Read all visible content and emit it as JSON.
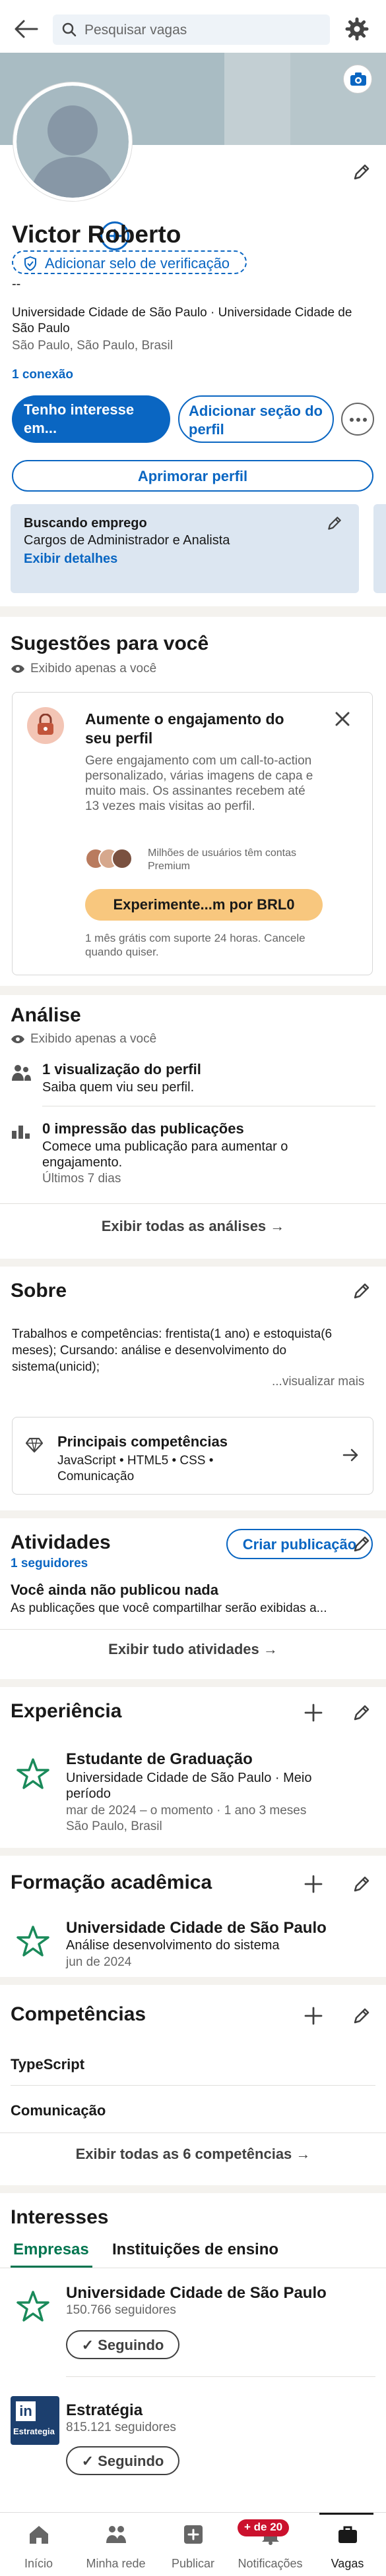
{
  "search": {
    "placeholder": "Pesquisar vagas"
  },
  "profile": {
    "name": "Victor Roberto",
    "verify_label": "Adicionar selo de verificação",
    "pronouns": "--",
    "headline": "Universidade Cidade de São Paulo · Universidade Cidade de São Paulo",
    "location": "São Paulo, São Paulo, Brasil",
    "connections": "1 conexão",
    "btn_interest": "Tenho interesse em...",
    "btn_add_section": "Adicionar seção do perfil",
    "btn_improve": "Aprimorar perfil",
    "job_status": {
      "title": "Buscando emprego",
      "roles": "Cargos de Administrador e Analista",
      "link": "Exibir detalhes"
    }
  },
  "suggestions": {
    "title": "Sugestões para você",
    "private": "Exibido apenas a você",
    "promo": {
      "title": "Aumente o engajamento do seu perfil",
      "body": "Gere engajamento com um call-to-action personalizado, várias imagens de capa e muito mais. Os assinantes recebem até 13 vezes mais visitas ao perfil.",
      "social": "Milhões de usuários têm contas Premium",
      "cta": "Experimente...m por BRL0",
      "footer": "1 mês grátis com suporte 24 horas. Cancele quando quiser."
    }
  },
  "analytics": {
    "title": "Análise",
    "private": "Exibido apenas a você",
    "items": [
      {
        "title": "1 visualização do perfil",
        "sub": "Saiba quem viu seu perfil.",
        "muted": ""
      },
      {
        "title": "0 impressão das publicações",
        "sub": "Comece uma publicação para aumentar o engajamento.",
        "muted": "Últimos 7 dias"
      }
    ],
    "show_all": "Exibir todas as análises →"
  },
  "about": {
    "title": "Sobre",
    "text": "Trabalhos e competências: frentista(1 ano) e estoquista(6 meses); Cursando: análise e desenvolvimento do sistema(unicid);",
    "more": "...visualizar mais",
    "top_skills_title": "Principais competências",
    "top_skills": "JavaScript • HTML5 • CSS • Comunicação"
  },
  "activity": {
    "title": "Atividades",
    "followers": "1 seguidores",
    "create_btn": "Criar publicação",
    "empty_title": "Você ainda não publicou nada",
    "empty_sub": "As publicações que você compartilhar serão exibidas a...",
    "show_all": "Exibir tudo atividades →"
  },
  "experience": {
    "title": "Experiência",
    "role": "Estudante de Graduação",
    "org": "Universidade Cidade de São Paulo · Meio período",
    "dates": "mar de 2024 – o momento · 1 ano 3 meses",
    "location": "São Paulo, Brasil"
  },
  "education": {
    "title": "Formação acadêmica",
    "school": "Universidade Cidade de São Paulo",
    "degree": "Análise desenvolvimento do sistema",
    "date": "jun de 2024"
  },
  "skills": {
    "title": "Competências",
    "items": [
      "TypeScript",
      "Comunicação"
    ],
    "show_all": "Exibir todas as 6 competências →"
  },
  "interests": {
    "title": "Interesses",
    "tabs": [
      "Empresas",
      "Instituições de ensino"
    ],
    "items": [
      {
        "name": "Universidade Cidade de São Paulo",
        "followers": "150.766 seguidores",
        "btn": "✓ Seguindo"
      },
      {
        "name": "Estratégia",
        "followers": "815.121 seguidores",
        "btn": "✓ Seguindo",
        "logo_text": "Estrategia"
      }
    ]
  },
  "nav": {
    "items": [
      "Início",
      "Minha rede",
      "Publicar",
      "Notificações",
      "Vagas"
    ],
    "badge": "+ de 20"
  },
  "colors": {
    "brand": "#0a66c2",
    "premium": "#f8c77e",
    "badge": "#cb112d"
  }
}
